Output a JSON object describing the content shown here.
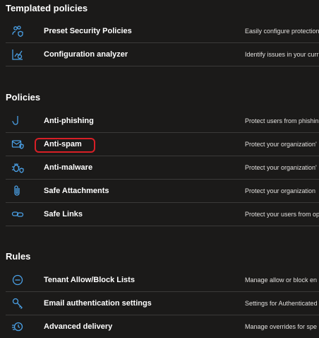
{
  "colors": {
    "background": "#1b1a19",
    "icon": "#4aa0e6",
    "divider": "#3b3a39",
    "highlight": "#d81f26"
  },
  "templated": {
    "title": "Templated policies",
    "items": [
      {
        "name": "Preset Security Policies",
        "desc": "Easily configure protection",
        "icon": "users-shield-icon"
      },
      {
        "name": "Configuration analyzer",
        "desc": "Identify issues in your curr",
        "icon": "chart-analyzer-icon"
      }
    ]
  },
  "policies": {
    "title": "Policies",
    "items": [
      {
        "name": "Anti-phishing",
        "desc": "Protect users from phishin",
        "icon": "fishing-hook-icon"
      },
      {
        "name": "Anti-spam",
        "desc": "Protect your organization'",
        "icon": "mail-shield-icon"
      },
      {
        "name": "Anti-malware",
        "desc": "Protect your organization'",
        "icon": "bug-shield-icon"
      },
      {
        "name": "Safe Attachments",
        "desc": "Protect your organization",
        "icon": "paperclip-icon"
      },
      {
        "name": "Safe Links",
        "desc": "Protect your users from op",
        "icon": "link-icon"
      }
    ]
  },
  "rules": {
    "title": "Rules",
    "items": [
      {
        "name": "Tenant Allow/Block Lists",
        "desc": "Manage allow or block en",
        "icon": "block-icon"
      },
      {
        "name": "Email authentication settings",
        "desc": "Settings for Authenticated",
        "icon": "key-icon"
      },
      {
        "name": "Advanced delivery",
        "desc": "Manage overrides for spe",
        "icon": "delivery-icon"
      }
    ]
  }
}
